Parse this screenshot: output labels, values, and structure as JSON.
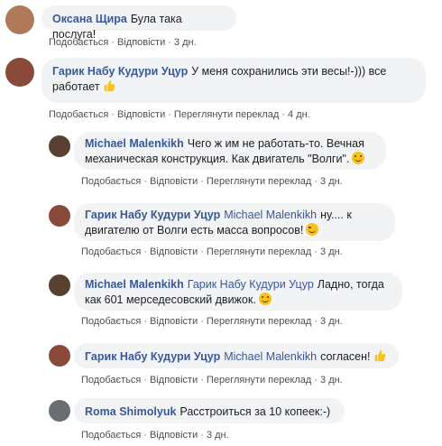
{
  "comments": [
    {
      "author": "Оксана Щира",
      "text": "Була така послуга!",
      "like": "Подобається",
      "reply": "Відповісти",
      "time": "3 дн.",
      "avatar_color": "#b07a5a"
    },
    {
      "author": "Гарик Набу Кудури Уцур",
      "text_line1": "У меня сохранились эти весы!-))) все",
      "text_line2": "работает",
      "like": "Подобається",
      "reply": "Відповісти",
      "translate": "Переглянути переклад",
      "time": "4 дн.",
      "avatar_color": "#8a4a3a"
    }
  ],
  "replies": [
    {
      "author": "Michael Malenkikh",
      "text_line1": "Чего ж им не работать-то. Вечная",
      "text_line2": "механическая конструкция. Как двигатель \"Волги\".",
      "like": "Подобається",
      "reply": "Відповісти",
      "translate": "Переглянути переклад",
      "time": "3 дн.",
      "avatar_color": "#5a4030"
    },
    {
      "author": "Гарик Набу Кудури Уцур",
      "mention": "Michael Malenkikh",
      "text_line1": "ну.... к",
      "text_line2": "двигателю от Волги есть масса вопросов!",
      "like": "Подобається",
      "reply": "Відповісти",
      "translate": "Переглянути переклад",
      "time": "3 дн.",
      "avatar_color": "#8a4a3a"
    },
    {
      "author": "Michael Malenkikh",
      "mention": "Гарик Набу Кудури Уцур",
      "text_line1": "Ладно, тогда",
      "text_line2": "как 601 мерседесовский движок.",
      "like": "Подобається",
      "reply": "Відповісти",
      "translate": "Переглянути переклад",
      "time": "3 дн.",
      "avatar_color": "#5a4030"
    },
    {
      "author": "Гарик Набу Кудури Уцур",
      "mention": "Michael Malenkikh",
      "text": "согласен!",
      "like": "Подобається",
      "reply": "Відповісти",
      "translate": "Переглянути переклад",
      "time": "3 дн.",
      "avatar_color": "#8a4a3a"
    },
    {
      "author": "Roma Shimolyuk",
      "text": "Расстроиться за 10 копеек:-)",
      "like": "Подобається",
      "reply": "Відповісти",
      "time": "3 дн.",
      "avatar_color": "#6a6e72"
    }
  ]
}
